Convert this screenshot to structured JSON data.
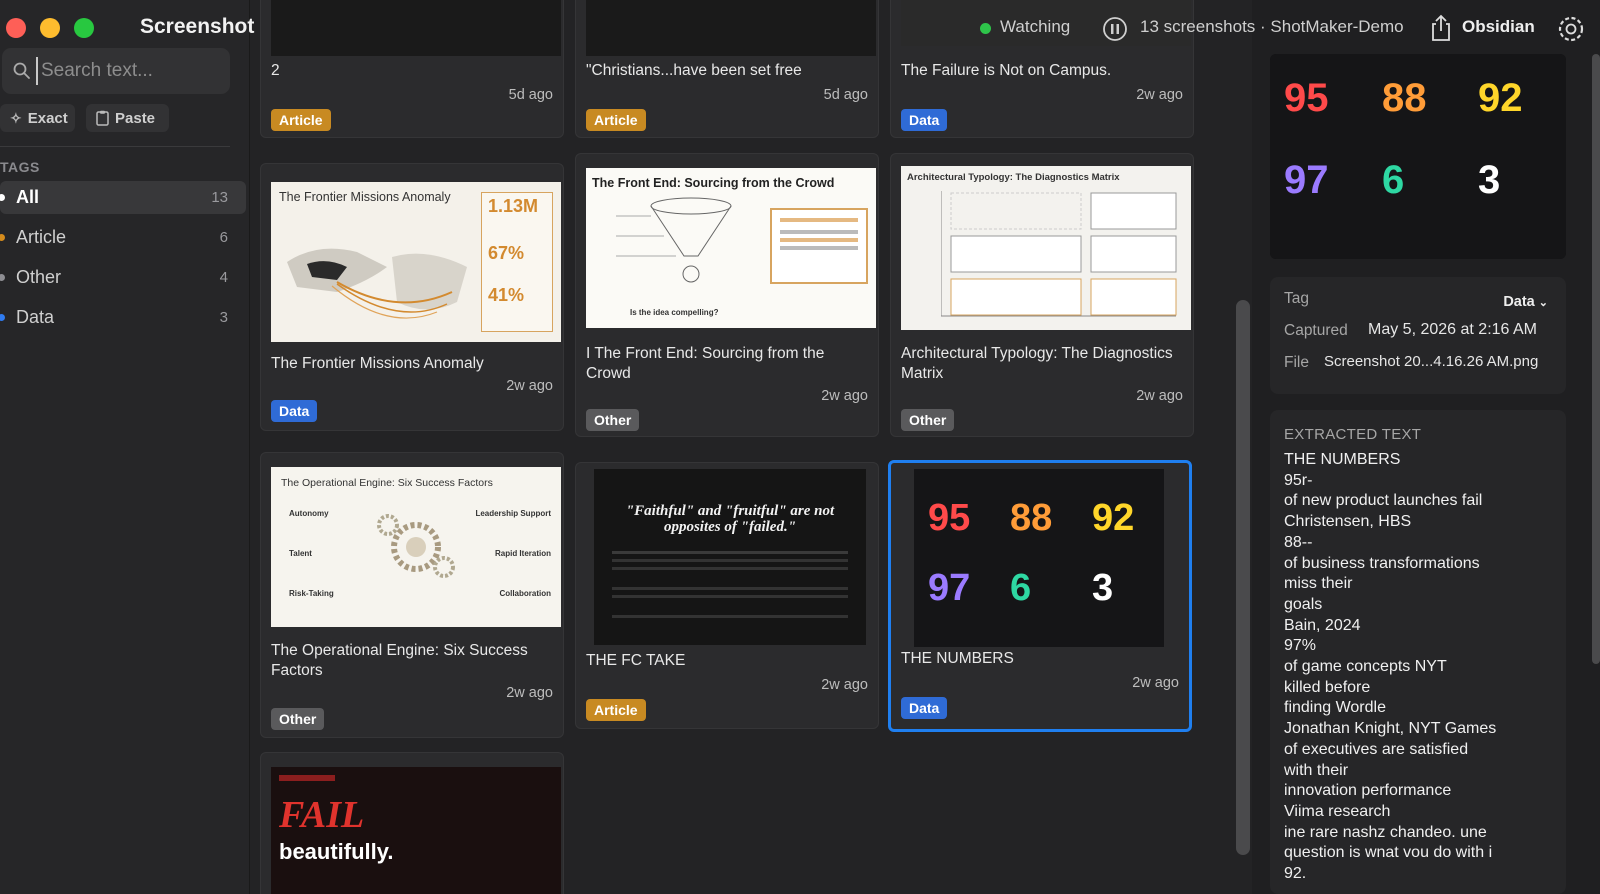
{
  "app": {
    "title": "Screenshot Recall"
  },
  "search": {
    "placeholder": "Search text..."
  },
  "actions": {
    "exact": "Exact",
    "paste": "Paste"
  },
  "tags": {
    "heading": "TAGS",
    "items": [
      {
        "label": "All",
        "count": "13",
        "color": "#ffffff"
      },
      {
        "label": "Article",
        "count": "6",
        "color": "#d48b1c"
      },
      {
        "label": "Other",
        "count": "4",
        "color": "#8e8e93"
      },
      {
        "label": "Data",
        "count": "3",
        "color": "#2f7bf0"
      }
    ]
  },
  "topbar": {
    "status": "Watching",
    "count_label": "13 screenshots · ShotMaker-Demo",
    "obsidian": "Obsidian"
  },
  "cards": [
    {
      "title": "2",
      "age": "5d ago",
      "tag": "Article"
    },
    {
      "title": "\"Christians...have been set free",
      "age": "5d ago",
      "tag": "Article"
    },
    {
      "title": "The Failure is Not on Campus.",
      "age": "2w ago",
      "tag": "Data"
    },
    {
      "title": "The Frontier Missions Anomaly",
      "age": "2w ago",
      "tag": "Data",
      "thumb": {
        "heading": "The Frontier Missions Anomaly",
        "stats": [
          "1.13M",
          "67%",
          "41%"
        ]
      }
    },
    {
      "title": "I The Front End: Sourcing from the Crowd",
      "age": "2w ago",
      "tag": "Other",
      "thumb": {
        "heading": "The Front End: Sourcing from the Crowd",
        "caption": "Is the idea compelling?"
      }
    },
    {
      "title": "Architectural Typology: The Diagnostics Matrix",
      "age": "2w ago",
      "tag": "Other",
      "thumb": {
        "heading": "Architectural Typology: The Diagnostics Matrix"
      }
    },
    {
      "title": "The Operational Engine: Six Success Factors",
      "age": "2w ago",
      "tag": "Other",
      "thumb": {
        "heading": "The Operational Engine: Six Success Factors",
        "labels": [
          "Autonomy",
          "Leadership Support",
          "Talent",
          "Rapid Iteration",
          "Risk-Taking",
          "Collaboration"
        ]
      }
    },
    {
      "title": "THE FC TAKE",
      "age": "2w ago",
      "tag": "Article",
      "thumb": {
        "quote": "\"Faithful\" and \"fruitful\" are not opposites of \"failed.\""
      }
    },
    {
      "title": "THE NUMBERS",
      "age": "2w ago",
      "tag": "Data",
      "thumb": {
        "numbers": [
          "95",
          "88",
          "92",
          "97",
          "6",
          "3"
        ]
      }
    },
    {
      "title": "",
      "age": "",
      "tag": "",
      "thumb": {
        "big": "FAIL",
        "sub": "beautifully."
      }
    }
  ],
  "detail": {
    "preview_numbers": [
      "95",
      "88",
      "92",
      "97",
      "6",
      "3"
    ],
    "tag_label": "Tag",
    "tag_value": "Data",
    "captured_label": "Captured",
    "captured_value": "May 5, 2026 at 2:16 AM",
    "file_label": "File",
    "file_value": "Screenshot 20...4.16.26 AM.png",
    "extracted_heading": "EXTRACTED TEXT",
    "extracted_lines": [
      "THE NUMBERS",
      "95r-",
      "of new product launches fail",
      "Christensen, HBS",
      "88--",
      "of business transformations",
      "miss their",
      "goals",
      "Bain, 2024",
      "97%",
      "of game concepts NYT",
      "killed before",
      "finding Wordle",
      "Jonathan Knight, NYT Games",
      "of executives are satisfied",
      "with their",
      "innovation performance",
      "Viima research",
      "ine rare nashz chandeo. une",
      "question is wnat vou do with i",
      "92."
    ]
  },
  "colors": {
    "accent": "#1f7ff0",
    "article": "#c88a22",
    "data": "#2f6bd6",
    "other": "#5a5a5c"
  }
}
